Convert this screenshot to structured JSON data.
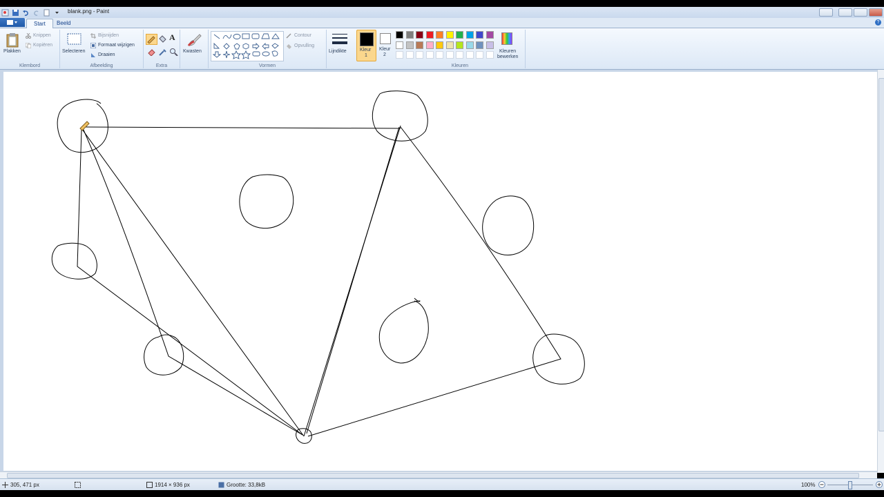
{
  "window": {
    "title": "blank.png - Paint"
  },
  "tabs": [
    {
      "label": "Start"
    },
    {
      "label": "Beeld"
    }
  ],
  "ribbon": {
    "klembord": {
      "group_label": "Klembord",
      "plakken": "Plakken",
      "knippen": "Knippen",
      "kopieren": "Kopiëren"
    },
    "afbeelding": {
      "group_label": "Afbeelding",
      "selecteren": "Selecteren",
      "bijsnijden": "Bijsnijden",
      "formaat": "Formaat wijzigen",
      "draaien": "Draaien"
    },
    "extra": {
      "group_label": "Extra"
    },
    "kwasten": {
      "label": "Kwasten"
    },
    "vormen": {
      "group_label": "Vormen",
      "contour": "Contour",
      "opvulling": "Opvulling"
    },
    "lijndikte": {
      "label": "Lijndikte"
    },
    "kleur1": {
      "label": "Kleur",
      "num": "1",
      "color": "#000000"
    },
    "kleur2": {
      "label": "Kleur",
      "num": "2",
      "color": "#ffffff"
    },
    "kleuren": {
      "group_label": "Kleuren",
      "palette_row1": [
        "#000000",
        "#7f7f7f",
        "#880015",
        "#ed1c24",
        "#ff7f27",
        "#fff200",
        "#22b14c",
        "#00a2e8",
        "#3f48cc",
        "#a349a4"
      ],
      "palette_row2": [
        "#ffffff",
        "#c3c3c3",
        "#b97a57",
        "#ffaec9",
        "#ffc90e",
        "#efe4b0",
        "#b5e61d",
        "#99d9ea",
        "#7092be",
        "#c8bfe7"
      ],
      "edit_label_1": "Kleuren",
      "edit_label_2": "bewerken"
    }
  },
  "status": {
    "cursor_pos": "305, 471 px",
    "image_size": "1914 × 936 px",
    "file_size": "Grootte: 33,8kB",
    "zoom": "100%"
  }
}
